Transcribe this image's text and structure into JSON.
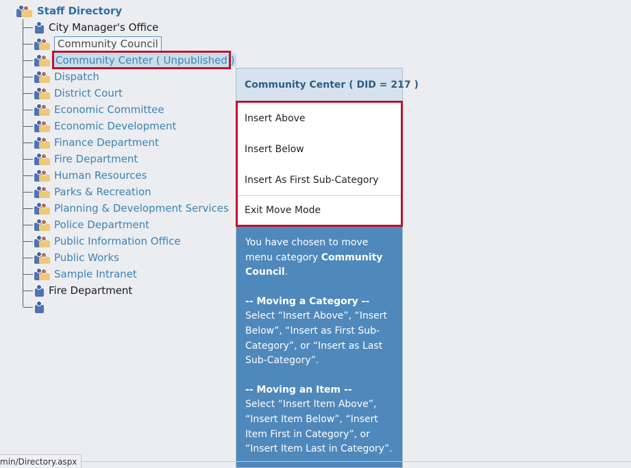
{
  "tree": {
    "root": "Staff Directory",
    "items": [
      {
        "label": "City Manager's Office",
        "style": "dark",
        "icon": "small"
      },
      {
        "label": "Community Council",
        "style": "outlined",
        "icon": "full"
      },
      {
        "label": "Community Center ( Unpublished )",
        "style": "selected",
        "icon": "full"
      },
      {
        "label": "Dispatch",
        "style": "link",
        "icon": "full"
      },
      {
        "label": "District Court",
        "style": "link",
        "icon": "full"
      },
      {
        "label": "Economic Committee",
        "style": "link",
        "icon": "full"
      },
      {
        "label": "Economic Development",
        "style": "link",
        "icon": "full"
      },
      {
        "label": "Finance Department",
        "style": "link",
        "icon": "full"
      },
      {
        "label": "Fire Department",
        "style": "link",
        "icon": "full"
      },
      {
        "label": "Human Resources",
        "style": "link",
        "icon": "full"
      },
      {
        "label": "Parks & Recreation",
        "style": "link",
        "icon": "full"
      },
      {
        "label": "Planning & Development Services",
        "style": "link",
        "icon": "full"
      },
      {
        "label": "Police Department",
        "style": "link",
        "icon": "full"
      },
      {
        "label": "Public Information Office",
        "style": "link",
        "icon": "full"
      },
      {
        "label": "Public Works",
        "style": "link",
        "icon": "full"
      },
      {
        "label": "Sample Intranet",
        "style": "link",
        "icon": "full"
      },
      {
        "label": "Fire Department",
        "style": "dark",
        "icon": "small"
      },
      {
        "label": "",
        "style": "dark",
        "icon": "small"
      }
    ]
  },
  "panel": {
    "title": "Community Center ( DID = 217 )",
    "menu": [
      "Insert Above",
      "Insert Below",
      "Insert As First Sub-Category",
      "Exit Move Mode"
    ],
    "info_intro": "You have chosen to move menu category ",
    "info_target": "Community Council",
    "info_intro_end": ".",
    "cat_heading": "-- Moving a Category --",
    "cat_text": "Select “Insert Above”, “Insert Below”, “Insert as First Sub-Category”, or “Insert as Last Sub-Category”.",
    "item_heading": "-- Moving an Item --",
    "item_text": "Select “Insert Item Above”, “Insert Item Below”, “Insert Item First in Category”, or “Insert Item Last in Category”."
  },
  "status": {
    "url": "min/Directory.aspx"
  },
  "colors": {
    "accent": "#3a82b5",
    "highlight": "#c0102d",
    "panel_bg": "#4f88bb"
  }
}
